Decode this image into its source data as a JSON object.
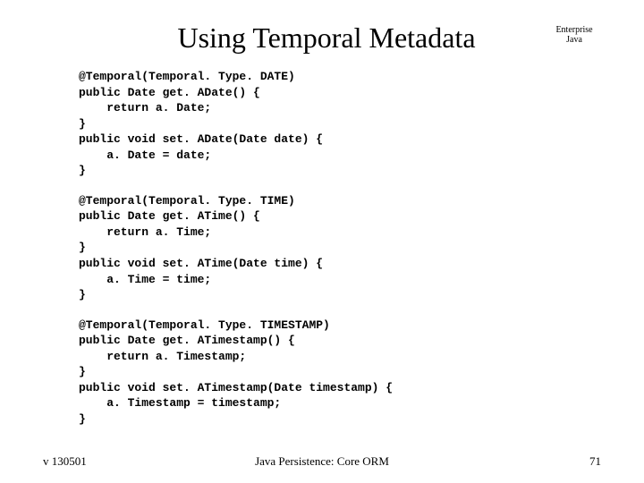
{
  "header": {
    "title": "Using Temporal Metadata",
    "corner_line1": "Enterprise",
    "corner_line2": "Java"
  },
  "code": {
    "block1": "@Temporal(Temporal. Type. DATE)\npublic Date get. ADate() {\n    return a. Date;\n}\npublic void set. ADate(Date date) {\n    a. Date = date;\n}",
    "block2": "@Temporal(Temporal. Type. TIME)\npublic Date get. ATime() {\n    return a. Time;\n}\npublic void set. ATime(Date time) {\n    a. Time = time;\n}",
    "block3": "@Temporal(Temporal. Type. TIMESTAMP)\npublic Date get. ATimestamp() {\n    return a. Timestamp;\n}\npublic void set. ATimestamp(Date timestamp) {\n    a. Timestamp = timestamp;\n}"
  },
  "footer": {
    "version": "v 130501",
    "center": "Java Persistence: Core ORM",
    "page": "71"
  }
}
